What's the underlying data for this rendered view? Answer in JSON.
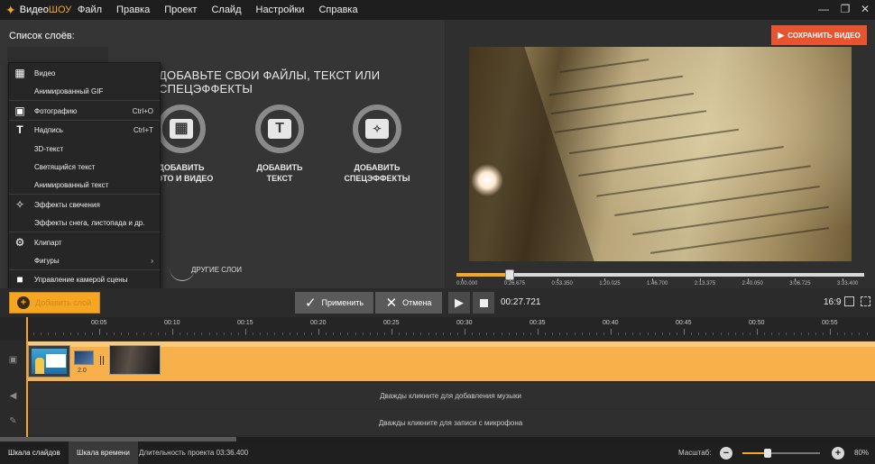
{
  "app": {
    "logo_prefix": "Видео",
    "logo_suffix": "ШОУ"
  },
  "menu": [
    "Файл",
    "Правка",
    "Проект",
    "Слайд",
    "Настройки",
    "Справка"
  ],
  "layers_panel": {
    "title": "Список слоёв:",
    "empty_title": "ДОБАВЬТЕ СВОИ ФАЙЛЫ, ТЕКСТ ИЛИ СПЕЦЭФФЕКТЫ",
    "add_photo_video": "ДОБАВИТЬ\nФОТО И ВИДЕО",
    "add_text": "ДОБАВИТЬ\nТЕКСТ",
    "add_effects": "ДОБАВИТЬ\nСПЕЦЭФФЕКТЫ",
    "other_layers": "ДРУГИЕ СЛОИ"
  },
  "dropdown": {
    "items": [
      {
        "label": "Видео",
        "icon": "film-icon",
        "shortcut": ""
      },
      {
        "label": "Анимированный GIF",
        "icon": "",
        "shortcut": ""
      },
      {
        "label": "Фотографию",
        "icon": "image-icon",
        "shortcut": "Ctrl+O"
      },
      {
        "label": "Надпись",
        "icon": "text-icon",
        "shortcut": "Ctrl+T"
      },
      {
        "label": "3D-текст",
        "icon": "",
        "shortcut": ""
      },
      {
        "label": "Светящийся текст",
        "icon": "",
        "shortcut": ""
      },
      {
        "label": "Анимированный текст",
        "icon": "",
        "shortcut": ""
      },
      {
        "label": "Эффекты свечения",
        "icon": "magic-wand-icon",
        "shortcut": ""
      },
      {
        "label": "Эффекты снега, листопада и др.",
        "icon": "",
        "shortcut": ""
      },
      {
        "label": "Клипарт",
        "icon": "gear-icon",
        "shortcut": ""
      },
      {
        "label": "Фигуры",
        "icon": "",
        "shortcut": ""
      },
      {
        "label": "Управление камерой сцены",
        "icon": "camera-icon",
        "shortcut": ""
      }
    ]
  },
  "preview": {
    "save_button": "СОХРАНИТЬ ВИДЕО",
    "seek_progress": 0.13,
    "seek_labels": [
      "0:00.000",
      "0:26.675",
      "0:53.350",
      "1:20.025",
      "1:46.700",
      "2:13.375",
      "2:40.050",
      "3:06.725",
      "3:33.400"
    ]
  },
  "controls": {
    "add_layer": "Добавить слой",
    "apply": "Применить",
    "cancel": "Отмена",
    "time": "00:27.721",
    "aspect": "16:9"
  },
  "timeline": {
    "ruler_labels": [
      "00:05",
      "00:10",
      "00:15",
      "00:20",
      "00:25",
      "00:30",
      "00:35",
      "00:40",
      "00:45",
      "00:50",
      "00:55"
    ],
    "transition_duration": "2.0",
    "music_hint": "Дважды кликните для добавления музыки",
    "mic_hint": "Дважды кликните для записи с микрофона"
  },
  "bottom": {
    "tab_slides": "Шкала слайдов",
    "tab_timeline": "Шкала времени",
    "duration": "Длительность проекта 03:36.400",
    "zoom_label": "Масштаб:",
    "zoom_value": "80%",
    "zoom_progress": 0.33
  },
  "colors": {
    "accent": "#f5a623",
    "save": "#e8542f"
  }
}
